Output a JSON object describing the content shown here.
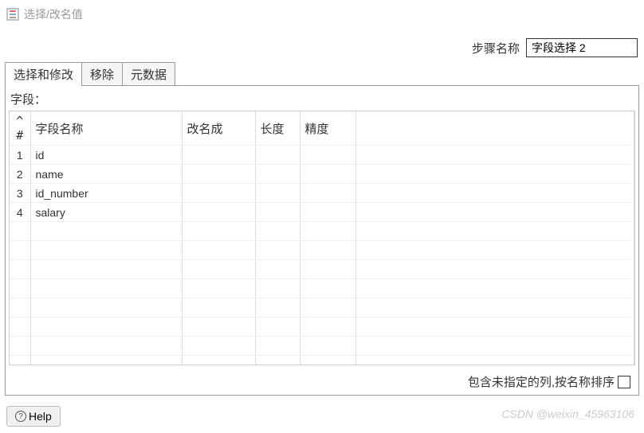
{
  "header": {
    "title": "选择/改名值"
  },
  "step": {
    "label": "步骤名称",
    "value": "字段选择 2"
  },
  "tabs": [
    {
      "label": "选择和修改",
      "active": true
    },
    {
      "label": "移除",
      "active": false
    },
    {
      "label": "元数据",
      "active": false
    }
  ],
  "fields_label": "字段：",
  "table": {
    "headers": {
      "num": "#",
      "fieldname": "字段名称",
      "rename": "改名成",
      "length": "长度",
      "precision": "精度"
    },
    "rows": [
      {
        "num": "1",
        "fieldname": "id",
        "rename": "",
        "length": "",
        "precision": ""
      },
      {
        "num": "2",
        "fieldname": "name",
        "rename": "",
        "length": "",
        "precision": ""
      },
      {
        "num": "3",
        "fieldname": "id_number",
        "rename": "",
        "length": "",
        "precision": ""
      },
      {
        "num": "4",
        "fieldname": "salary",
        "rename": "",
        "length": "",
        "precision": ""
      }
    ]
  },
  "footer": {
    "include_label": "包含未指定的列,按名称排序"
  },
  "help": {
    "label": "Help"
  },
  "watermark": "CSDN @weixin_45963106"
}
